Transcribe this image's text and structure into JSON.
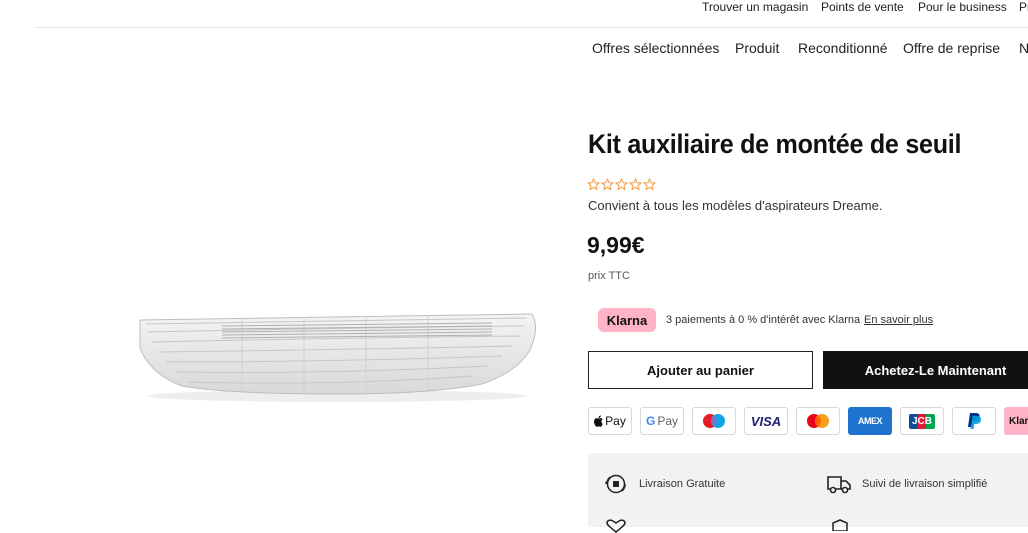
{
  "topbar": {
    "links": [
      "Trouver un magasin",
      "Points de vente",
      "Pour le business",
      "Pr"
    ]
  },
  "mainnav": {
    "items": [
      "Offres sélectionnées",
      "Produit",
      "Reconditionné",
      "Offre de reprise",
      "N"
    ]
  },
  "product": {
    "title": "Kit auxiliaire de montée de seuil",
    "rating": 0,
    "rating_max": 5,
    "compatibility": "Convient à tous les modèles d'aspirateurs Dreame.",
    "price": "9,99€",
    "price_note": "prix TTC"
  },
  "klarna": {
    "badge": "Klarna",
    "text": "3 paiements à 0 % d'intérêt avec Klarna",
    "link": "En savoir plus"
  },
  "buttons": {
    "add_to_cart": "Ajouter au panier",
    "buy_now": "Achetez-Le Maintenant"
  },
  "payments": {
    "applepay": "Pay",
    "gpay": "Pay",
    "visa": "VISA",
    "amex": "AMEX",
    "jcb": "JCB",
    "klarna": "Klar"
  },
  "features": {
    "free_shipping": "Livraison Gratuite",
    "tracking": "Suivi de livraison simplifié"
  },
  "colors": {
    "star": "#f0a050",
    "klarna_pink": "#ffb3c7",
    "buy_button": "#111111",
    "panel_bg": "#f2f2f2"
  }
}
